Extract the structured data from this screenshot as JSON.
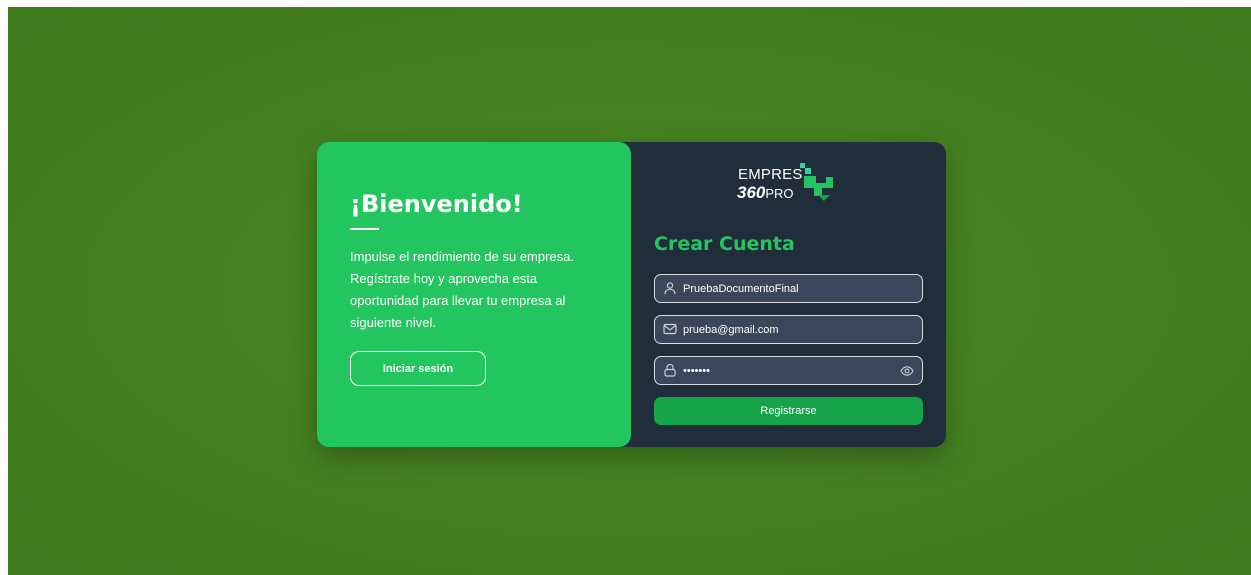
{
  "welcome": {
    "title": "¡Bienvenido!",
    "message": "Impulse el rendimiento de su empresa. Regístrate hoy y aprovecha esta oportunidad para llevar tu empresa al siguiente nivel.",
    "login_label": "Iniciar sesión"
  },
  "logo": {
    "line1": "EMPRES",
    "number": "360",
    "suffix": "PRO"
  },
  "form": {
    "title": "Crear Cuenta",
    "username": {
      "value": "PruebaDocumentoFinal",
      "icon": "user-icon"
    },
    "email": {
      "value": "prueba@gmail.com",
      "icon": "mail-icon"
    },
    "password": {
      "value": "•••••••",
      "icon": "lock-icon",
      "toggle_icon": "eye-icon"
    },
    "submit_label": "Registrarse"
  },
  "colors": {
    "page_background": "#447f20",
    "accent_green": "#22c55e",
    "button_green": "#16a34a",
    "dark_panel": "#1f2e3a",
    "input_background": "#3a4659"
  }
}
